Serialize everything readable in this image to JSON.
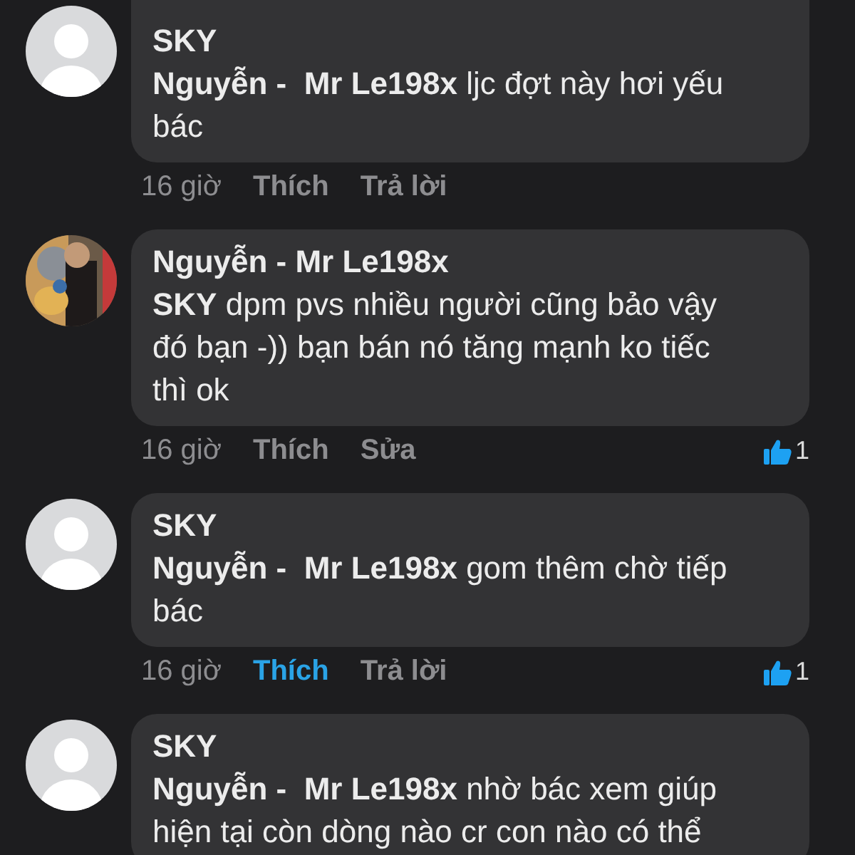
{
  "comments": [
    {
      "kind": "default",
      "author": "SKY",
      "reply_to": "Nguyễn -  Mr Le198x",
      "text": "ljc đợt này hơi yếu bác",
      "time": "16 giờ",
      "like_label": "Thích",
      "liked": false,
      "second_action": "Trả lời"
    },
    {
      "kind": "picture",
      "author": "Nguyễn -  Mr Le198x",
      "reply_to": "SKY",
      "text": "dpm pvs nhiều người cũng bảo vậy đó bạn -)) bạn bán nó tăng mạnh ko tiếc thì ok",
      "time": "16 giờ",
      "like_label": "Thích",
      "liked": false,
      "second_action": "Sửa",
      "reaction_count": "1"
    },
    {
      "kind": "default",
      "author": "SKY",
      "reply_to": "Nguyễn -  Mr Le198x",
      "text": "gom thêm chờ tiếp bác",
      "time": "16 giờ",
      "like_label": "Thích",
      "liked": true,
      "second_action": "Trả lời",
      "reaction_count": "1"
    },
    {
      "kind": "default",
      "author": "SKY",
      "reply_to": "Nguyễn -  Mr Le198x",
      "text": "nhờ bác xem giúp hiện tại còn dòng nào cr con nào có thể"
    }
  ]
}
